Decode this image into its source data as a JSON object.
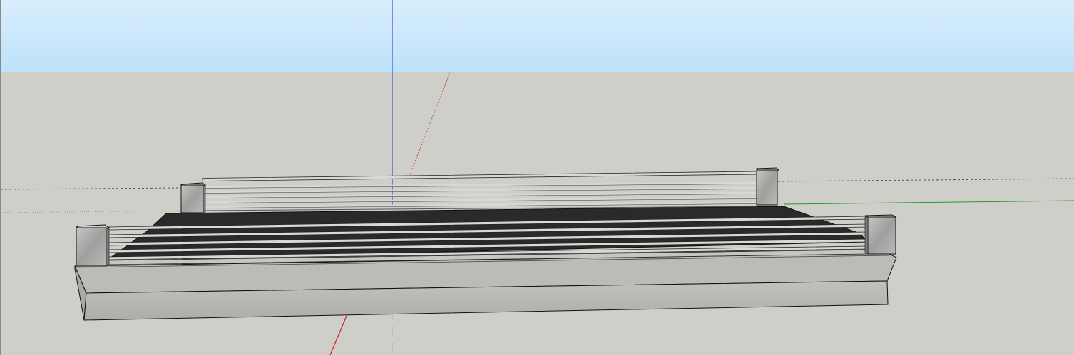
{
  "viewport": {
    "sky_top_color": "#d6ecfa",
    "sky_bottom_color": "#bfe3fb",
    "ground_color": "#cfcfca"
  },
  "axes": {
    "red_axis_color": "#cc2020",
    "green_axis_color": "#1f9a1f",
    "blue_axis_color": "#2b2bd8"
  },
  "model": {
    "deck_color": "#2a2a2a",
    "concrete_color": "#b6b6b1",
    "post_color": "#aeb0ae",
    "rail_color": "#d8d8d4",
    "outline_color": "#111111"
  }
}
